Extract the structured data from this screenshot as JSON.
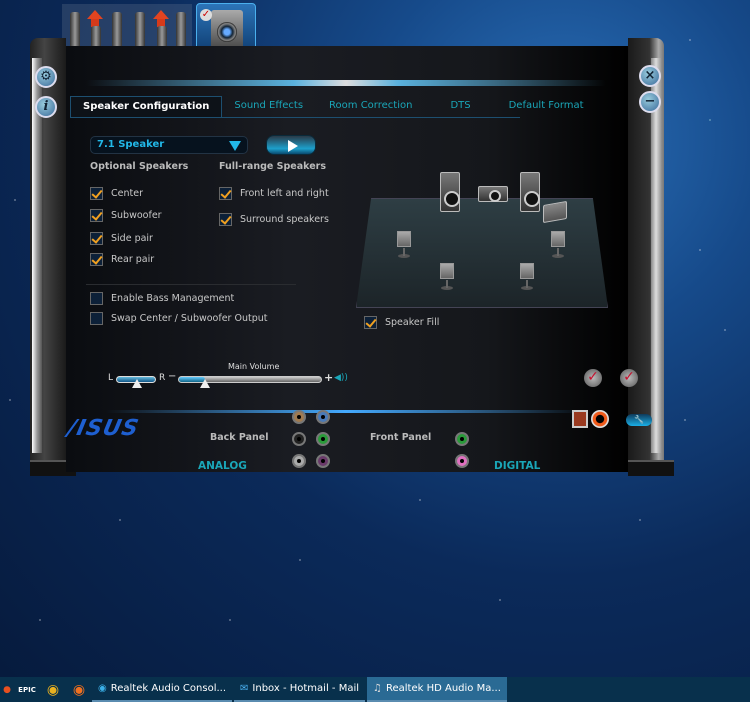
{
  "device_tabs": {
    "active": "speakers-device"
  },
  "window": {
    "side_buttons": {
      "settings": "settings-icon",
      "info": "info-icon",
      "close": "close-icon",
      "minimize": "minimize-icon"
    },
    "tabs": [
      {
        "label": "Speaker Configuration",
        "active": true
      },
      {
        "label": "Sound Effects",
        "active": false
      },
      {
        "label": "Room Correction",
        "active": false
      },
      {
        "label": "DTS",
        "active": false
      },
      {
        "label": "Default Format",
        "active": false
      }
    ],
    "speaker_config": {
      "dropdown_value": "7.1 Speaker",
      "optional_speakers_label": "Optional Speakers",
      "full_range_label": "Full-range Speakers",
      "optional": [
        {
          "label": "Center",
          "checked": true
        },
        {
          "label": "Subwoofer",
          "checked": true
        },
        {
          "label": "Side pair",
          "checked": true
        },
        {
          "label": "Rear pair",
          "checked": true
        }
      ],
      "full_range": [
        {
          "label": "Front left and right",
          "checked": true
        },
        {
          "label": "Surround speakers",
          "checked": true
        }
      ],
      "extras": [
        {
          "label": "Enable Bass Management",
          "checked": false
        },
        {
          "label": "Swap Center / Subwoofer Output",
          "checked": false
        }
      ],
      "speaker_fill": {
        "label": "Speaker Fill",
        "checked": true
      }
    },
    "volume": {
      "left_label": "L",
      "right_label": "R",
      "minus": "−",
      "plus": "+",
      "title": "Main Volume",
      "balance_percent": 50,
      "main_percent": 18,
      "speaker_icon": "◀))"
    },
    "bottom": {
      "logo": "/ISUS",
      "back_panel": "Back Panel",
      "front_panel": "Front Panel",
      "analog": "ANALOG",
      "digital": "DIGITAL",
      "back_ports": [
        "#a07a50",
        "#4a7ab8",
        "#222222",
        "#2a9a3a",
        "#aaaaaa",
        "#6a3a6a"
      ],
      "front_ports": [
        "#2a9a3a",
        "#e070c0"
      ],
      "wrench": "🔧"
    }
  },
  "taskbar": {
    "pinned": [
      "EPIC"
    ],
    "items": [
      {
        "label": "Realtek Audio Consol...",
        "icon": "◉",
        "active": false
      },
      {
        "label": "Inbox - Hotmail - Mail",
        "icon": "✉",
        "active": false
      },
      {
        "label": "Realtek HD Audio Ma...",
        "icon": "♫",
        "active": true
      }
    ]
  }
}
